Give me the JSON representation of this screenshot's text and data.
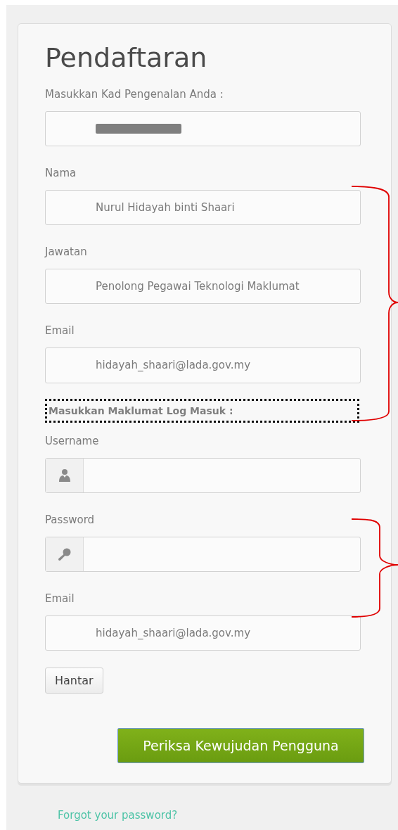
{
  "title": "Pendaftaran",
  "items": [
    {
      "kind": "label",
      "text": "Masukkan Kad Pengenalan Anda :"
    },
    {
      "kind": "field",
      "redacted": true
    },
    {
      "kind": "label",
      "text": "Nama"
    },
    {
      "kind": "field",
      "value": "Nurul Hidayah binti Shaari"
    },
    {
      "kind": "label",
      "text": "Jawatan"
    },
    {
      "kind": "field",
      "value": "Penolong Pegawai Teknologi Maklumat"
    },
    {
      "kind": "label",
      "text": "Email"
    },
    {
      "kind": "field",
      "value": "hidayah_shaari@lada.gov.my"
    },
    {
      "kind": "heading",
      "text": "Masukkan Maklumat Log Masuk :",
      "highlighted": true
    },
    {
      "kind": "label",
      "text": "Username"
    },
    {
      "kind": "user-field"
    },
    {
      "kind": "label",
      "text": "Password"
    },
    {
      "kind": "key-field"
    },
    {
      "kind": "label",
      "text": "Email"
    },
    {
      "kind": "field",
      "value": "hidayah_shaari@lada.gov.my"
    }
  ],
  "submit_button": "Hantar",
  "check_button": "Periksa Kewujudan Pengguna",
  "forgot_link": "Forgot your password?",
  "annotations": [
    {
      "kind": "bracket"
    },
    {
      "kind": "bracket"
    }
  ]
}
